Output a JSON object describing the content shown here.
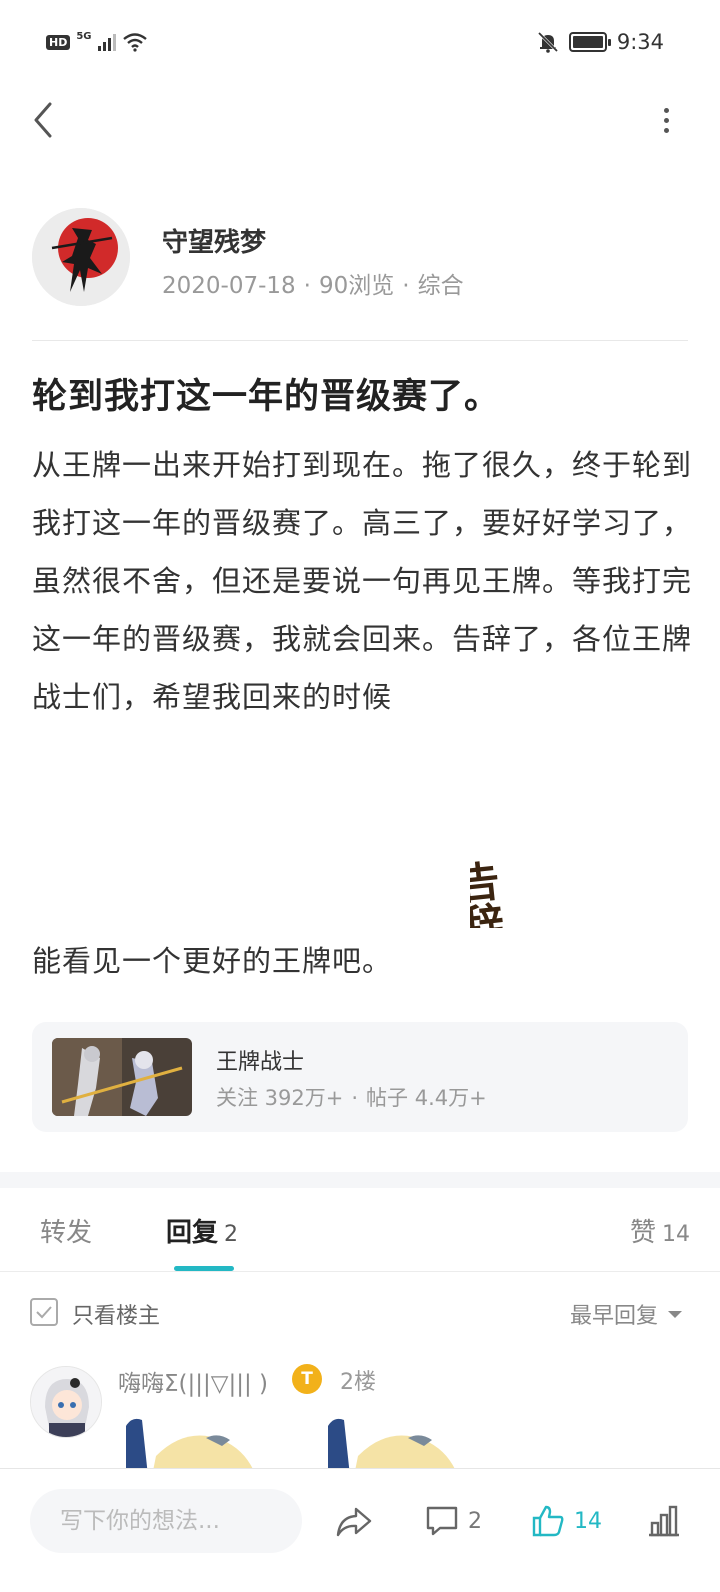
{
  "status_bar": {
    "hd": "HD",
    "network": "5G",
    "time": "9:34"
  },
  "author": {
    "name": "守望残梦",
    "date": "2020-07-18",
    "views": "90浏览",
    "category": "综合"
  },
  "post": {
    "title": "轮到我打这一年的晋级赛了。",
    "body": "从王牌一出来开始打到现在。拖了很久，终于轮到我打这一年的晋级赛了。高三了，要好好学习了，虽然很不舍，但还是要说一句再见王牌。等我打完这一年的晋级赛，我就会回来。告辞了，各位王牌战士们，希望我回来的时候",
    "sticker_text": "告辞",
    "tail": "能看见一个更好的王牌吧。"
  },
  "forum": {
    "name": "王牌战士",
    "followers": "关注 392万+",
    "posts": "帖子 4.4万+"
  },
  "tabs": {
    "forward": "转发",
    "reply": "回复",
    "reply_count": "2",
    "like": "赞",
    "like_count": "14"
  },
  "filter": {
    "only_op": "只看楼主",
    "sort": "最早回复"
  },
  "reply": {
    "name": "嗨嗨Σ(|||▽||| )",
    "badge": "T",
    "floor": "2楼"
  },
  "bottom_bar": {
    "placeholder": "写下你的想法...",
    "comment_count": "2",
    "like_count": "14"
  },
  "colors": {
    "accent": "#23b8c4",
    "badge": "#f2b11a"
  }
}
